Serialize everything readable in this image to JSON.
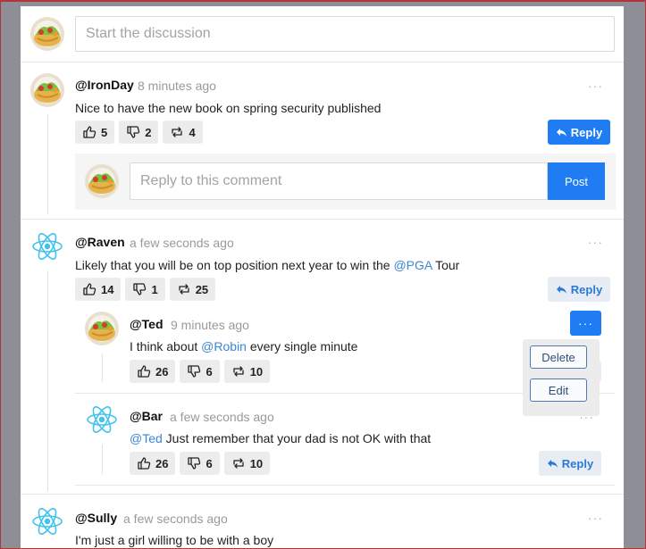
{
  "composer": {
    "placeholder": "Start the discussion"
  },
  "comments": [
    {
      "username": "@IronDay",
      "time": "8 minutes ago",
      "text": "Nice to have the new book on spring security published",
      "likes": "5",
      "dislikes": "2",
      "shares": "4",
      "reply_label": "Reply",
      "reply_box": {
        "placeholder": "Reply to this comment",
        "post_label": "Post"
      }
    },
    {
      "username": "@Raven",
      "time": "a few seconds ago",
      "text_before": "Likely that you will be on top position next year to win the ",
      "mention": "@PGA",
      "text_after": " Tour",
      "likes": "14",
      "dislikes": "1",
      "shares": "25",
      "reply_label": "Reply",
      "replies": [
        {
          "username": "@Ted",
          "time": "9 minutes ago",
          "text_before": "I think about ",
          "mention": "@Robin",
          "text_after": " every single minute",
          "likes": "26",
          "dislikes": "6",
          "shares": "10",
          "more_label": "···",
          "menu": {
            "delete_label": "Delete",
            "edit_label": "Edit"
          }
        },
        {
          "username": "@Bar",
          "time": "a few seconds ago",
          "mention": "@Ted",
          "text_after": " Just remember that your dad is not OK with that",
          "likes": "26",
          "dislikes": "6",
          "shares": "10",
          "reply_label": "Reply"
        }
      ]
    },
    {
      "username": "@Sully",
      "time": "a few seconds ago",
      "text": "I'm just a girl willing to be with a boy"
    }
  ],
  "more_icon_text": "···",
  "colors": {
    "primary": "#1f7cf2",
    "mention": "#3b86d6",
    "react": "#3fc3ee"
  }
}
